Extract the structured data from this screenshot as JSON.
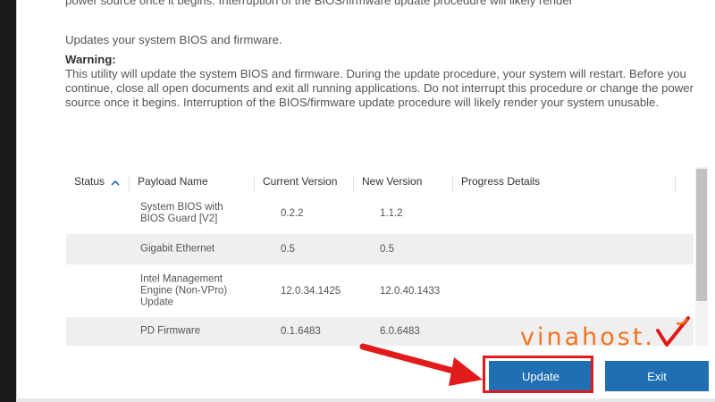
{
  "text": {
    "top_partial": "power source once it begins. Interruption of the BIOS/firmware update procedure will likely render",
    "intro": "Updates your system BIOS and firmware.",
    "warning_title": "Warning:",
    "warning_body": "This utility will update the system BIOS and firmware. During the update procedure, your system will restart. Before you continue, close all open documents and exit all running applications. Do not interrupt this procedure or change the power source once it begins. Interruption of the BIOS/firmware update procedure will likely render your system unusable."
  },
  "table": {
    "columns": [
      "Status",
      "Payload Name",
      "Current Version",
      "New Version",
      "Progress Details"
    ],
    "rows": [
      {
        "payload": "System BIOS with BIOS Guard [V2]",
        "current": "0.2.2",
        "new": "1.1.2"
      },
      {
        "payload": "Gigabit Ethernet",
        "current": "0.5",
        "new": "0.5"
      },
      {
        "payload": "Intel Management Engine (Non-VPro) Update",
        "current": "12.0.34.1425",
        "new": "12.0.40.1433"
      },
      {
        "payload": "PD Firmware",
        "current": "0.1.6483",
        "new": "6.0.6483"
      }
    ]
  },
  "buttons": {
    "update": "Update",
    "exit": "Exit"
  },
  "watermark": {
    "text": "vinahost."
  },
  "colors": {
    "button": "#1f6fb2",
    "highlight": "#e11b1b",
    "logo": "#f37321"
  },
  "icons": {
    "sort": "chevron-up-icon",
    "arrow": "red-arrow-icon"
  }
}
